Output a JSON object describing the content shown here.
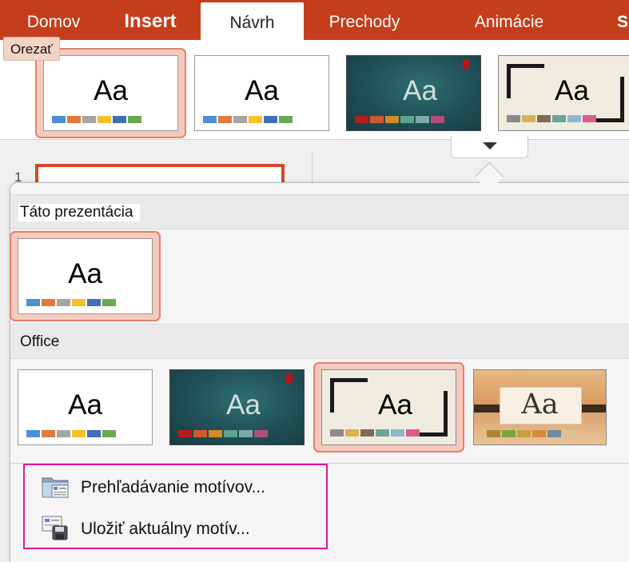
{
  "ribbon": {
    "tabs": [
      {
        "label": "Domov"
      },
      {
        "label": "Insert"
      },
      {
        "label": "Návrh",
        "active": true
      },
      {
        "label": "Prechody"
      },
      {
        "label": "Animácie"
      },
      {
        "label": "S"
      }
    ],
    "tooltip": "Orezať",
    "accent_color": "#c43e1c"
  },
  "ribbon_themes": [
    {
      "style": "white",
      "label": "Aa",
      "selected": true,
      "colors": [
        "#4e8fd2",
        "#e07b39",
        "#a5a5a5",
        "#f5c02c",
        "#3f6fb7",
        "#6aa84f"
      ]
    },
    {
      "style": "white",
      "label": "Aa",
      "selected": false,
      "colors": [
        "#4e8fd2",
        "#e07b39",
        "#a5a5a5",
        "#f5c02c",
        "#3f6fb7",
        "#6aa84f"
      ]
    },
    {
      "style": "teal",
      "label": "Aa",
      "selected": false,
      "colors": [
        "#b51d1d",
        "#d0582f",
        "#d18a2c",
        "#59a58d",
        "#7ea9ab",
        "#b14f79"
      ]
    },
    {
      "style": "frame",
      "label": "Aa",
      "selected": false,
      "colors": [
        "#8b8b8b",
        "#d8b24e",
        "#7f6b56",
        "#6aa59a",
        "#8fb7c9",
        "#d95c8b"
      ]
    }
  ],
  "slide_panel": {
    "slide_number": "1"
  },
  "popover": {
    "section_this": {
      "title": "Táto prezentácia",
      "themes": [
        {
          "style": "white",
          "label": "Aa",
          "selected": true,
          "colors": [
            "#4e8fd2",
            "#e07b39",
            "#a5a5a5",
            "#f5c02c",
            "#3f6fb7",
            "#6aa84f"
          ]
        }
      ]
    },
    "section_office": {
      "title": "Office",
      "themes": [
        {
          "style": "white",
          "label": "Aa",
          "selected": false,
          "colors": [
            "#4e8fd2",
            "#e07b39",
            "#a5a5a5",
            "#f5c02c",
            "#3f6fb7",
            "#6aa84f"
          ]
        },
        {
          "style": "teal",
          "label": "Aa",
          "selected": false,
          "colors": [
            "#b51d1d",
            "#d0582f",
            "#d18a2c",
            "#59a58d",
            "#7ea9ab",
            "#b14f79"
          ]
        },
        {
          "style": "frame",
          "label": "Aa",
          "selected": true,
          "colors": [
            "#8b8b8b",
            "#d8b24e",
            "#7f6b56",
            "#6aa59a",
            "#8fb7c9",
            "#d95c8b"
          ]
        },
        {
          "style": "wood",
          "label": "Aa",
          "selected": false,
          "colors": [
            "#a9882d",
            "#7ea33c",
            "#c6a03b",
            "#d78a3e",
            "#6f8b9f",
            "#d8c29a"
          ]
        }
      ]
    },
    "actions": [
      {
        "label": "Prehľadávanie motívov...",
        "icon": "folder-browse-icon"
      },
      {
        "label": "Uložiť aktuálny motív...",
        "icon": "save-theme-icon"
      }
    ],
    "highlight_color": "#e0169b"
  }
}
